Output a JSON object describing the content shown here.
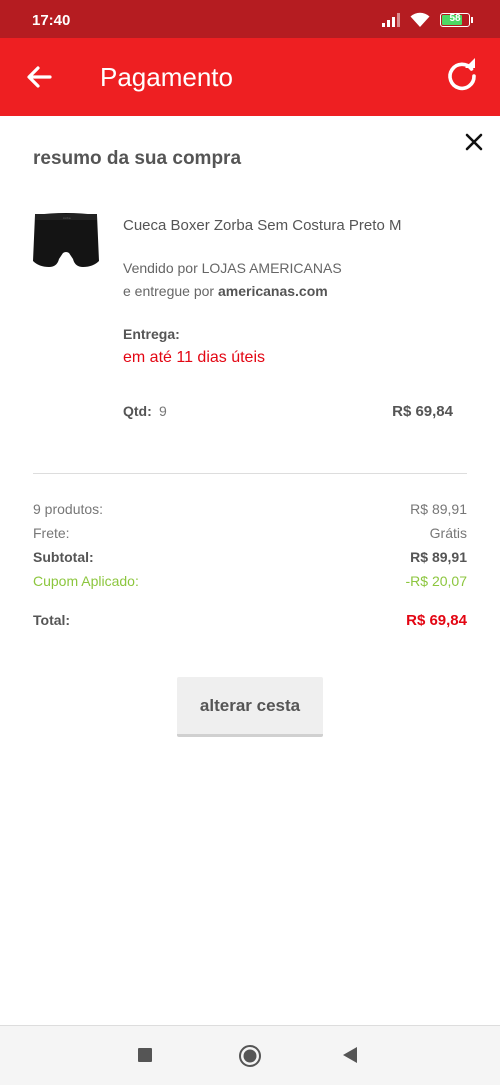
{
  "status_bar": {
    "time": "17:40",
    "battery": "58",
    "icons": [
      "signal-icon",
      "wifi-icon",
      "battery-icon"
    ]
  },
  "app_bar": {
    "title": "Pagamento",
    "back_icon": "arrow-left-icon",
    "refresh_icon": "refresh-icon",
    "background": "#ee1f22"
  },
  "summary": {
    "title": "resumo da sua compra",
    "close_icon": "close-icon"
  },
  "product": {
    "name": "Cueca Boxer Zorba Sem Costura Preto M",
    "seller": "Vendido por LOJAS AMERICANAS",
    "delivered_prefix": "e entregue por ",
    "delivered_by": "americanas.com",
    "delivery_label": "Entrega:",
    "delivery_time": "em até 11 dias úteis",
    "qty_label": "Qtd:",
    "qty": "9",
    "price": "R$ 69,84"
  },
  "totals": {
    "products_label": "9 produtos:",
    "products_value": "R$ 89,91",
    "freight_label": "Frete:",
    "freight_value": "Grátis",
    "subtotal_label": "Subtotal:",
    "subtotal_value": "R$ 89,91",
    "coupon_label": "Cupom Aplicado:",
    "coupon_value": "-R$ 20,07",
    "total_label": "Total:",
    "total_value": "R$ 69,84"
  },
  "actions": {
    "alter_cart": "alterar cesta"
  },
  "colors": {
    "accent_red": "#e30613",
    "coupon_green": "#8cc63e",
    "status_bar": "#b51c21"
  },
  "nav_bar": {
    "icons": [
      "square-recents-icon",
      "circle-home-icon",
      "triangle-back-icon"
    ]
  }
}
